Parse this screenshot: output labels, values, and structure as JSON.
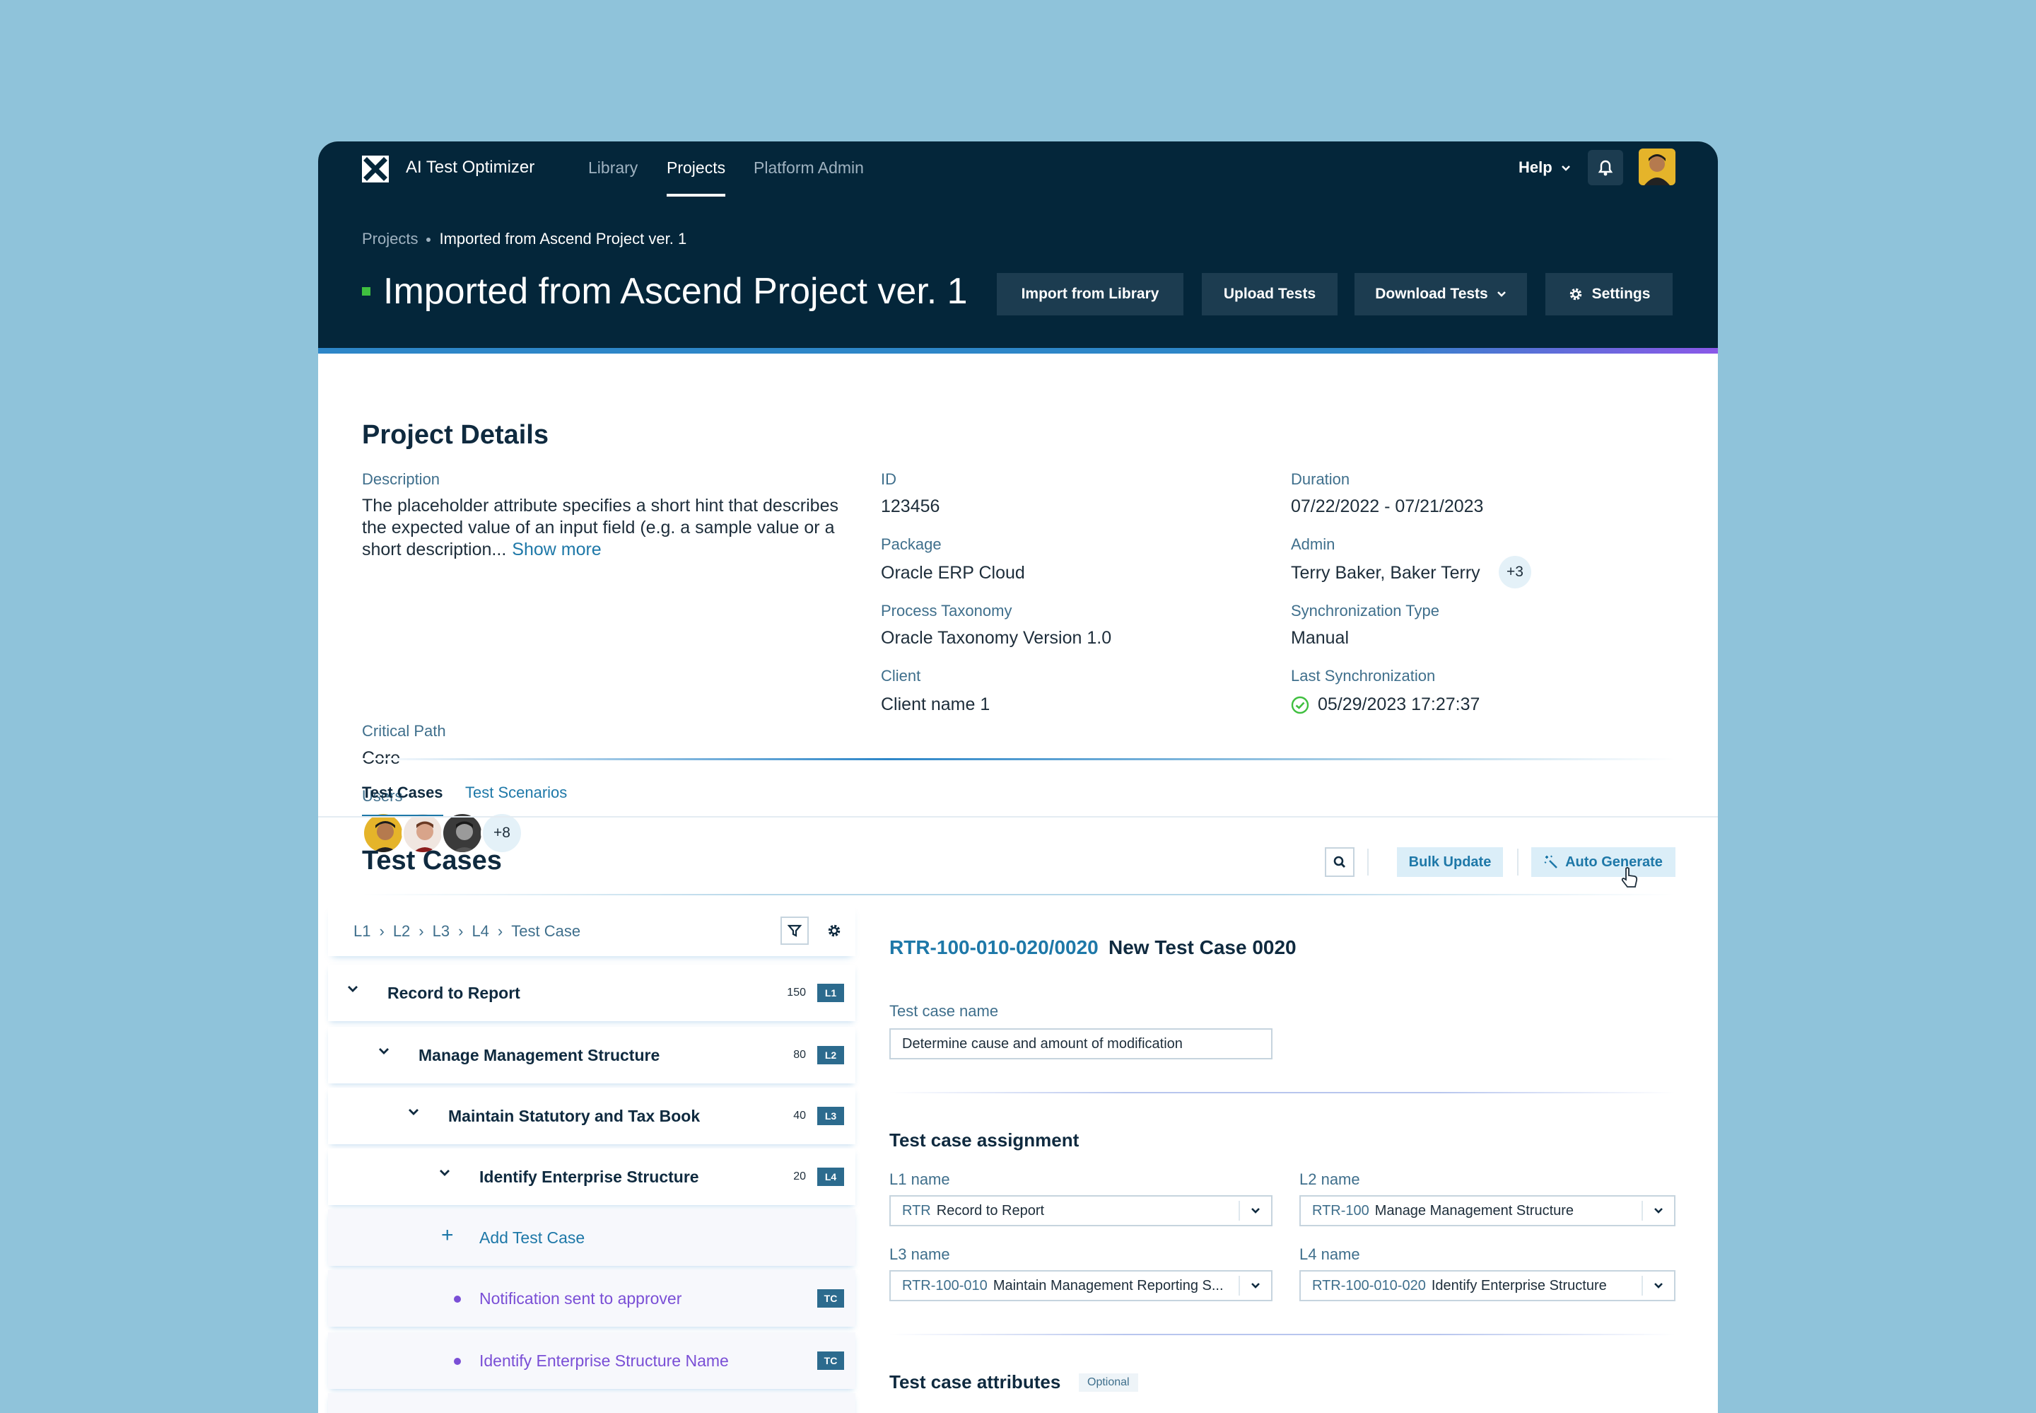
{
  "header": {
    "brand": "AI Test Optimizer",
    "nav": [
      {
        "label": "Library",
        "active": false
      },
      {
        "label": "Projects",
        "active": true
      },
      {
        "label": "Platform Admin",
        "active": false
      }
    ],
    "help_label": "Help",
    "icons": {
      "logo": "x-logo-icon",
      "bell": "bell-icon",
      "avatar": "user-avatar"
    }
  },
  "breadcrumb": {
    "root": "Projects",
    "current": "Imported from Ascend Project ver. 1"
  },
  "page_title": "Imported from Ascend Project ver. 1",
  "actions": {
    "import": "Import from Library",
    "upload": "Upload Tests",
    "download": "Download Tests",
    "settings": "Settings"
  },
  "project_details": {
    "title": "Project Details",
    "description_label": "Description",
    "description": "The placeholder attribute specifies a short hint that describes the expected value of an input field (e.g. a sample value or a short description...",
    "show_more": "Show more",
    "critical_path_label": "Critical Path",
    "critical_path": "Core",
    "users_label": "Users",
    "users_more": "+8",
    "id_label": "ID",
    "id": "123456",
    "package_label": "Package",
    "package": "Oracle ERP Cloud",
    "taxonomy_label": "Process Taxonomy",
    "taxonomy": "Oracle Taxonomy Version 1.0",
    "client_label": "Client",
    "client": "Client name 1",
    "duration_label": "Duration",
    "duration": "07/22/2022 - 07/21/2023",
    "admin_label": "Admin",
    "admin": "Terry Baker, Baker Terry",
    "admin_more": "+3",
    "sync_type_label": "Synchronization Type",
    "sync_type": "Manual",
    "last_sync_label": "Last Synchronization",
    "last_sync": "05/29/2023 17:27:37"
  },
  "tabs": [
    {
      "label": "Test Cases",
      "active": true
    },
    {
      "label": "Test Scenarios",
      "active": false
    }
  ],
  "test_cases": {
    "title": "Test Cases",
    "bulk_update": "Bulk Update",
    "auto_generate": "Auto Generate"
  },
  "tree": {
    "path": [
      "L1",
      "L2",
      "L3",
      "L4",
      "Test Case"
    ],
    "rows": [
      {
        "label": "Record to Report",
        "count": "150",
        "badge": "L1"
      },
      {
        "label": "Manage Management Structure",
        "count": "80",
        "badge": "L2"
      },
      {
        "label": "Maintain Statutory and Tax Book",
        "count": "40",
        "badge": "L3"
      },
      {
        "label": "Identify Enterprise Structure",
        "count": "20",
        "badge": "L4"
      },
      {
        "label": "Add Test Case"
      },
      {
        "label": "Notification sent to approver",
        "badge": "TC"
      },
      {
        "label": "Identify Enterprise Structure Name",
        "badge": "TC"
      }
    ]
  },
  "detail": {
    "id": "RTR-100-010-020/0020",
    "name": "New Test Case 0020",
    "name_label": "Test case name",
    "name_value": "Determine cause and amount of modification",
    "assignment_title": "Test case assignment",
    "l1_label": "L1 name",
    "l1_code": "RTR",
    "l1_value": "Record to Report",
    "l2_label": "L2 name",
    "l2_code": "RTR-100",
    "l2_value": "Manage Management Structure",
    "l3_label": "L3 name",
    "l3_code": "RTR-100-010",
    "l3_value": "Maintain Management Reporting S...",
    "l4_label": "L4 name",
    "l4_code": "RTR-100-010-020",
    "l4_value": "Identify Enterprise Structure",
    "attributes_title": "Test case attributes",
    "optional": "Optional"
  },
  "colors": {
    "header_bg": "#04263a",
    "accent": "#1e78a8",
    "status_green": "#3fbf3f",
    "test_case_purple": "#7a4fd6",
    "badge_bg": "#2c6b8e"
  }
}
